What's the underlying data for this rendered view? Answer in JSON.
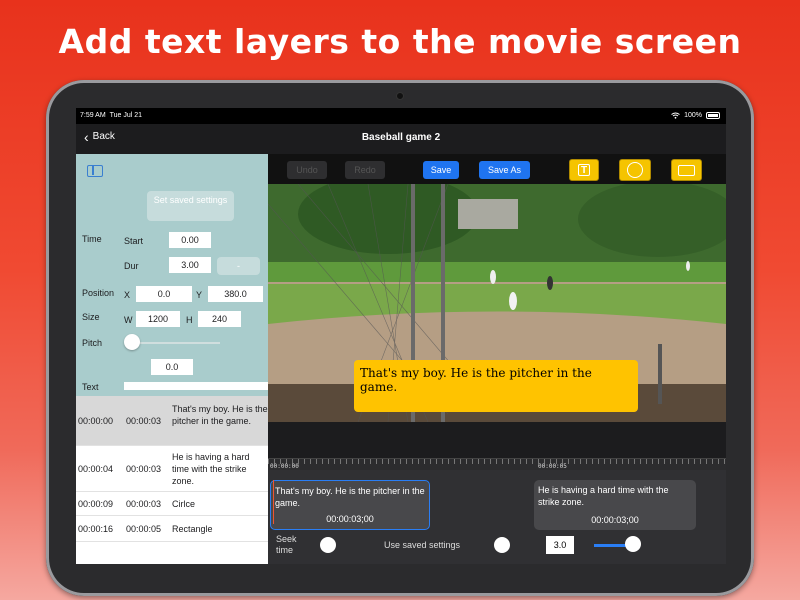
{
  "headline": "Add text layers to the movie screen",
  "status": {
    "time": "7:59 AM",
    "date": "Tue Jul 21",
    "battery": "100%"
  },
  "nav": {
    "back": "Back",
    "title": "Baseball game 2"
  },
  "panel": {
    "set_saved": "Set saved settings",
    "time_label": "Time",
    "start_label": "Start",
    "start_value": "0.00",
    "dur_label": "Dur",
    "dur_value": "3.00",
    "stepper_value": "-",
    "position_label": "Position",
    "x_label": "X",
    "x_value": "0.0",
    "y_label": "Y",
    "y_value": "380.0",
    "size_label": "Size",
    "w_label": "W",
    "w_value": "1200",
    "h_label": "H",
    "h_value": "240",
    "pitch_label": "Pitch",
    "pitch_value": "0.0",
    "text_label": "Text"
  },
  "layers": [
    {
      "start": "00:00:00",
      "dur": "00:00:03",
      "text": "That's my boy.  He is the pitcher in the game."
    },
    {
      "start": "00:00:04",
      "dur": "00:00:03",
      "text": "He is having a hard time with the strike zone."
    },
    {
      "start": "00:00:09",
      "dur": "00:00:03",
      "text": "Cirlce"
    },
    {
      "start": "00:00:16",
      "dur": "00:00:05",
      "text": "Rectangle"
    }
  ],
  "toolbar": {
    "undo": "Undo",
    "redo": "Redo",
    "save": "Save",
    "save_as": "Save As"
  },
  "caption": "That's my boy.  He is the pitcher in the game.",
  "timeline": {
    "label_start": "00:00:00",
    "label_mid": "00:00:05",
    "clips": [
      {
        "text": "That's my boy.  He is the pitcher in the game.",
        "dur": "00:00:03;00"
      },
      {
        "text": "He is having a hard time with the strike zone.",
        "dur": "00:00:03;00"
      }
    ]
  },
  "bottom": {
    "seek": "Seek time",
    "use_saved": "Use saved settings",
    "speed": "3.0"
  },
  "colors": {
    "accent": "#1f74f0",
    "caption_bg": "#ffc300",
    "panel_bg": "#a9cccc"
  }
}
